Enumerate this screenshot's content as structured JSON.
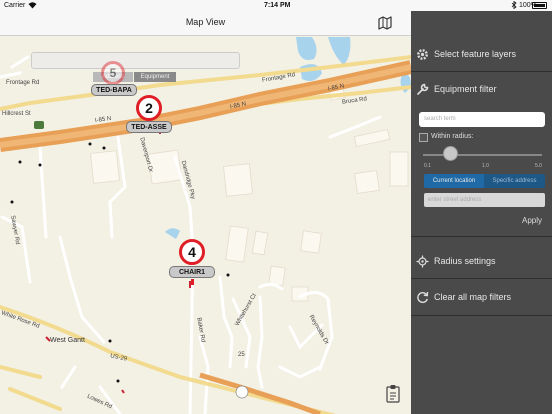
{
  "status_bar": {
    "carrier": "Carrier",
    "time": "7:14 PM",
    "battery": "100%"
  },
  "nav": {
    "title": "Map View",
    "map_icon": "map-icon"
  },
  "map": {
    "segmented": [
      "Address",
      "Equipment"
    ],
    "pins": [
      {
        "number": "5",
        "label": "TED-BAPA"
      },
      {
        "number": "2",
        "label": "TED-ASSE"
      },
      {
        "number": "4",
        "label": "CHAIR1"
      }
    ],
    "labels": [
      "Frontage Rd",
      "Frontage Rd",
      "Bruca Rd",
      "I-85 N",
      "I-85 N",
      "I-85 N",
      "Hillcrest St",
      "Davenport Dr",
      "Dandridge Pky",
      "Sawyer Rd",
      "Baker Rd",
      "Whitehurst Ct",
      "Reynolds Dr",
      "White Rose Rd",
      "West Gantt",
      "US-29",
      "Lowes Rd"
    ],
    "route_badge": "25"
  },
  "panel": {
    "select_layers": "Select feature layers",
    "equipment_filter": "Equipment filter",
    "search_placeholder": "search term",
    "within_radius": "Within radius:",
    "ticks": [
      "0.1",
      "1.0",
      "5.0"
    ],
    "current_location": "Current location",
    "specific_address": "Specific address",
    "address_placeholder": "enter street address",
    "apply": "Apply",
    "radius_settings": "Radius settings",
    "clear_filters": "Clear all map filters"
  }
}
